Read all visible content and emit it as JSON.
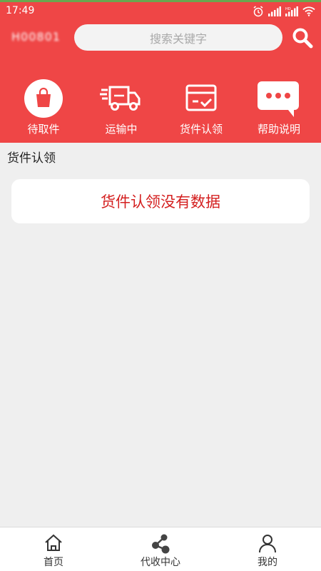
{
  "status_bar": {
    "time": "17:49"
  },
  "header": {
    "account_id": "H00801",
    "search_placeholder": "搜索关键字"
  },
  "quick_nav": [
    {
      "label": "待取件",
      "icon": "shopping-bag-icon"
    },
    {
      "label": "运输中",
      "icon": "truck-icon"
    },
    {
      "label": "货件认领",
      "icon": "claim-card-icon"
    },
    {
      "label": "帮助说明",
      "icon": "chat-bubble-icon"
    }
  ],
  "section": {
    "title": "货件认领"
  },
  "empty_state": {
    "message": "货件认领没有数据"
  },
  "tab_bar": [
    {
      "label": "首页",
      "icon": "home-icon"
    },
    {
      "label": "代收中心",
      "icon": "share-nodes-icon"
    },
    {
      "label": "我的",
      "icon": "user-icon"
    }
  ],
  "colors": {
    "primary": "#ef4646",
    "empty_text": "#d42020",
    "background": "#efefef"
  }
}
